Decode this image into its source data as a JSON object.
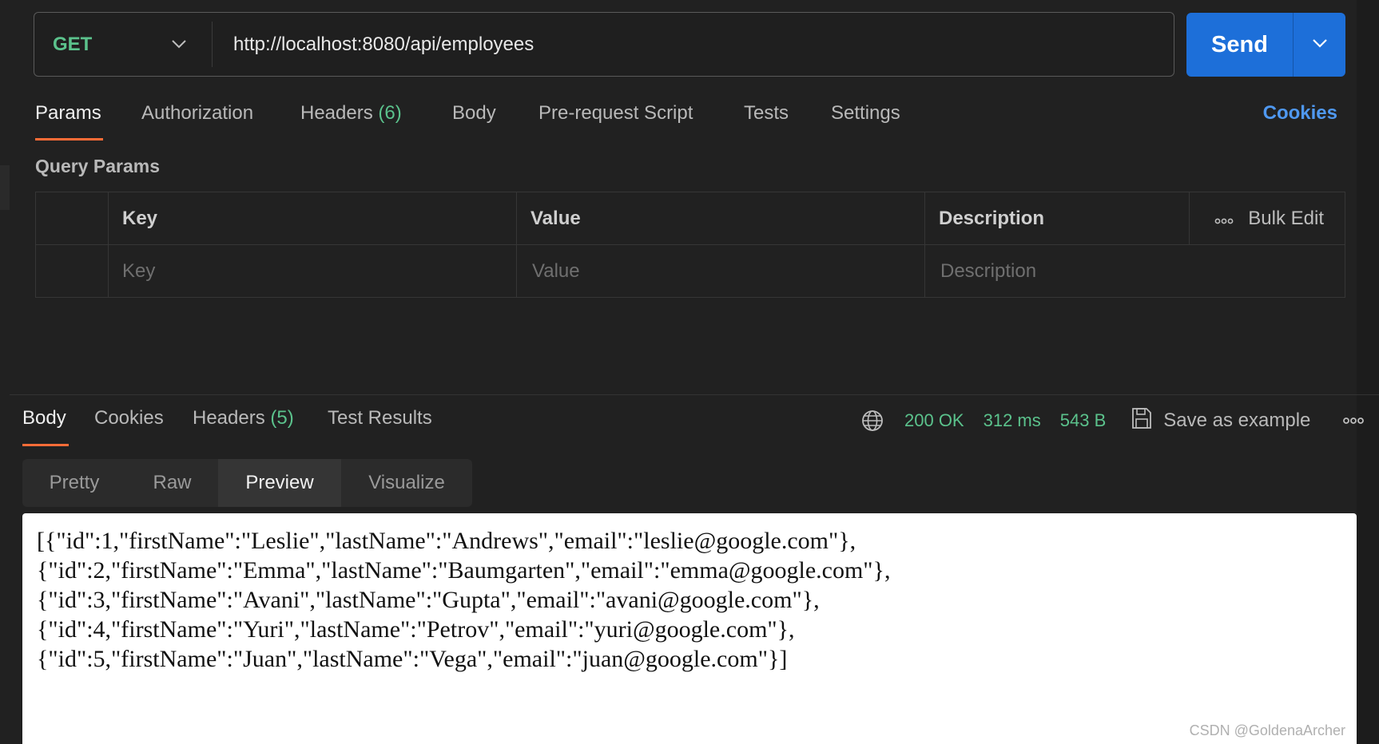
{
  "request": {
    "method": "GET",
    "url": "http://localhost:8080/api/employees",
    "send_label": "Send"
  },
  "request_tabs": {
    "params": "Params",
    "authorization": "Authorization",
    "headers": "Headers",
    "headers_count": "(6)",
    "body": "Body",
    "prerequest": "Pre-request Script",
    "tests": "Tests",
    "settings": "Settings",
    "cookies": "Cookies"
  },
  "query_params": {
    "title": "Query Params",
    "columns": {
      "key": "Key",
      "value": "Value",
      "description": "Description"
    },
    "bulk_edit": "Bulk Edit",
    "placeholders": {
      "key": "Key",
      "value": "Value",
      "description": "Description"
    }
  },
  "response_tabs": {
    "body": "Body",
    "cookies": "Cookies",
    "headers": "Headers",
    "headers_count": "(5)",
    "test_results": "Test Results"
  },
  "response_meta": {
    "status": "200 OK",
    "time": "312 ms",
    "size": "543 B",
    "save_example": "Save as example"
  },
  "view_tabs": {
    "pretty": "Pretty",
    "raw": "Raw",
    "preview": "Preview",
    "visualize": "Visualize"
  },
  "preview_lines": [
    "[{\"id\":1,\"firstName\":\"Leslie\",\"lastName\":\"Andrews\",\"email\":\"leslie@google.com\"},",
    "{\"id\":2,\"firstName\":\"Emma\",\"lastName\":\"Baumgarten\",\"email\":\"emma@google.com\"},",
    "{\"id\":3,\"firstName\":\"Avani\",\"lastName\":\"Gupta\",\"email\":\"avani@google.com\"},",
    "{\"id\":4,\"firstName\":\"Yuri\",\"lastName\":\"Petrov\",\"email\":\"yuri@google.com\"},",
    "{\"id\":5,\"firstName\":\"Juan\",\"lastName\":\"Vega\",\"email\":\"juan@google.com\"}]"
  ],
  "watermark": "CSDN @GoldenaArcher",
  "colors": {
    "accent_orange": "#ff6c37",
    "send_blue": "#1d6fd9",
    "status_green": "#5bc28c",
    "link_blue": "#4f98f0"
  },
  "icons": [
    "chevron-down-icon",
    "globe-icon",
    "save-icon",
    "more-icon"
  ]
}
